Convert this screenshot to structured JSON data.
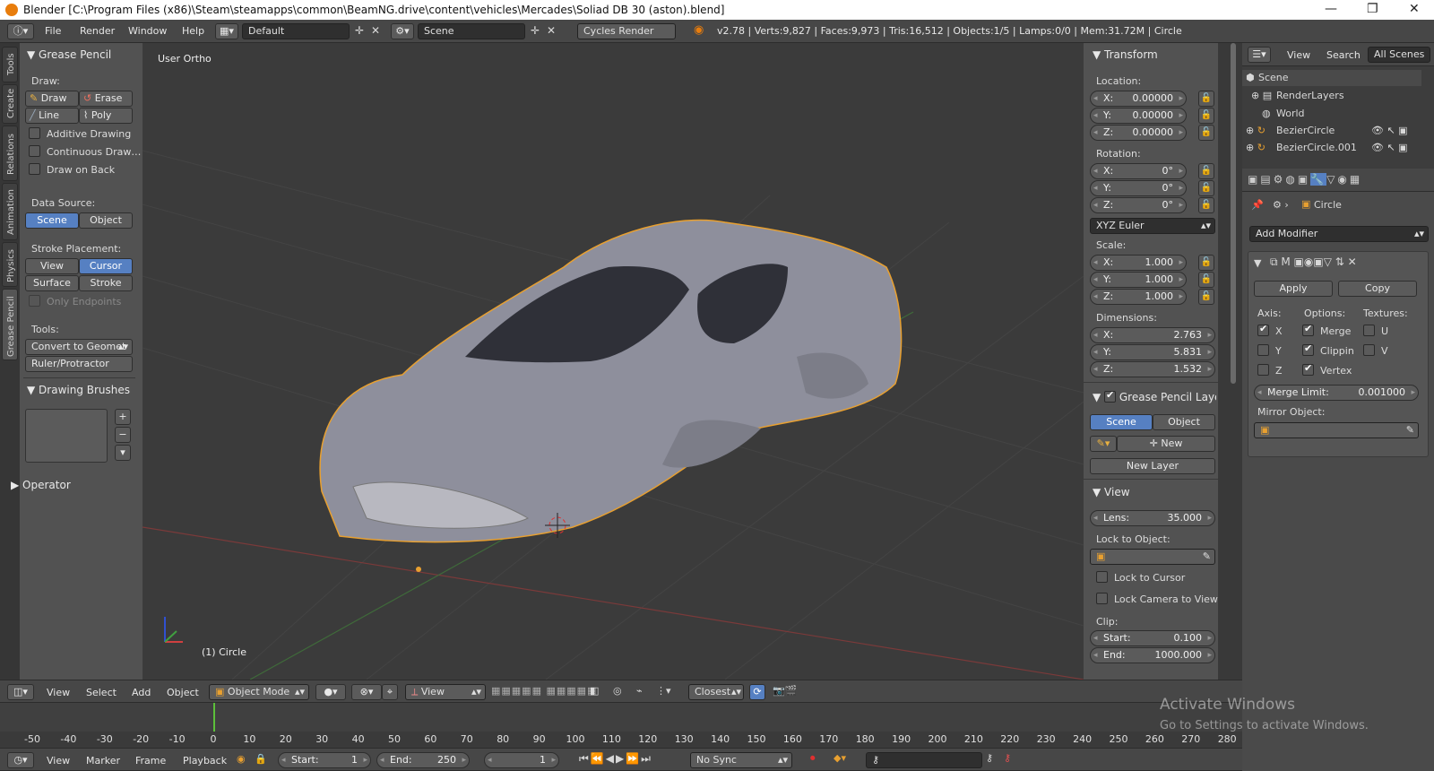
{
  "window": {
    "title": "Blender [C:\\Program Files (x86)\\Steam\\steamapps\\common\\BeamNG.drive\\content\\vehicles\\Mercades\\Soliad DB 30 (aston).blend]",
    "minimize": "—",
    "restore": "❐",
    "close": "✕"
  },
  "topbar": {
    "menus": [
      "File",
      "Render",
      "Window",
      "Help"
    ],
    "layout": "Default",
    "scene": "Scene",
    "engine": "Cycles Render",
    "stats": "v2.78 | Verts:9,827 | Faces:9,973 | Tris:16,512 | Objects:1/5 | Lamps:0/0 | Mem:31.72M | Circle"
  },
  "vtabs": [
    "Tools",
    "Create",
    "Relations",
    "Animation",
    "Physics",
    "Grease Pencil"
  ],
  "grease": {
    "title": "Grease Pencil",
    "draw_label": "Draw:",
    "draw": "Draw",
    "erase": "Erase",
    "line": "Line",
    "poly": "Poly",
    "additive": "Additive Drawing",
    "continuous": "Continuous Draw…",
    "drawback": "Draw on Back",
    "data_source": "Data Source:",
    "scene": "Scene",
    "object": "Object",
    "stroke_placement": "Stroke Placement:",
    "view": "View",
    "cursor": "Cursor",
    "surface": "Surface",
    "stroke": "Stroke",
    "only_endpoints": "Only Endpoints",
    "tools": "Tools:",
    "convert": "Convert to Geomet",
    "ruler": "Ruler/Protractor",
    "brushes": "Drawing Brushes",
    "operator": "Operator"
  },
  "viewport": {
    "label": "User Ortho",
    "object": "(1) Circle"
  },
  "transform": {
    "title": "Transform",
    "location": "Location:",
    "rotation": "Rotation:",
    "scale": "Scale:",
    "dimensions": "Dimensions:",
    "loc": [
      {
        "l": "X:",
        "v": "0.00000"
      },
      {
        "l": "Y:",
        "v": "0.00000"
      },
      {
        "l": "Z:",
        "v": "0.00000"
      }
    ],
    "rot": [
      {
        "l": "X:",
        "v": "0°"
      },
      {
        "l": "Y:",
        "v": "0°"
      },
      {
        "l": "Z:",
        "v": "0°"
      }
    ],
    "euler": "XYZ Euler",
    "scl": [
      {
        "l": "X:",
        "v": "1.000"
      },
      {
        "l": "Y:",
        "v": "1.000"
      },
      {
        "l": "Z:",
        "v": "1.000"
      }
    ],
    "dim": [
      {
        "l": "X:",
        "v": "2.763"
      },
      {
        "l": "Y:",
        "v": "5.831"
      },
      {
        "l": "Z:",
        "v": "1.532"
      }
    ]
  },
  "gplayers": {
    "title": "Grease Pencil Layers",
    "scene": "Scene",
    "object": "Object",
    "new": "New",
    "new_layer": "New Layer"
  },
  "viewpanel": {
    "title": "View",
    "lens_l": "Lens:",
    "lens_v": "35.000",
    "lock_obj": "Lock to Object:",
    "lock_cursor": "Lock to Cursor",
    "lock_cam": "Lock Camera to View",
    "clip": "Clip:",
    "start_l": "Start:",
    "start_v": "0.100",
    "end_l": "End:",
    "end_v": "1000.000"
  },
  "outliner": {
    "view": "View",
    "search": "Search",
    "all": "All Scenes",
    "items": [
      "Scene",
      "RenderLayers",
      "World",
      "BezierCircle",
      "BezierCircle.001"
    ]
  },
  "props": {
    "object": "Circle",
    "add_modifier": "Add Modifier",
    "apply": "Apply",
    "copy": "Copy",
    "axis": "Axis:",
    "options": "Options:",
    "textures": "Textures:",
    "x": "X",
    "y": "Y",
    "z": "Z",
    "merge": "Merge",
    "clipping": "Clippin",
    "vertex": "Vertex",
    "u": "U",
    "v": "V",
    "merge_limit_l": "Merge Limit:",
    "merge_limit_v": "0.001000",
    "mirror_obj": "Mirror Object:"
  },
  "viewhdr": {
    "menus": [
      "View",
      "Select",
      "Add",
      "Object"
    ],
    "mode": "Object Mode",
    "view": "View",
    "snap": "Closest"
  },
  "timeline": {
    "ticks": [
      "-50",
      "-40",
      "-30",
      "-20",
      "-10",
      "0",
      "10",
      "20",
      "30",
      "40",
      "50",
      "60",
      "70",
      "80",
      "90",
      "100",
      "110",
      "120",
      "130",
      "140",
      "150",
      "160",
      "170",
      "180",
      "190",
      "200",
      "210",
      "220",
      "230",
      "240",
      "250",
      "260",
      "270",
      "280"
    ],
    "menus": [
      "View",
      "Marker",
      "Frame",
      "Playback"
    ],
    "start_l": "Start:",
    "start_v": "1",
    "end_l": "End:",
    "end_v": "250",
    "current": "1",
    "sync": "No Sync"
  },
  "watermark": {
    "line1": "Activate Windows",
    "line2": "Go to Settings to activate Windows."
  }
}
